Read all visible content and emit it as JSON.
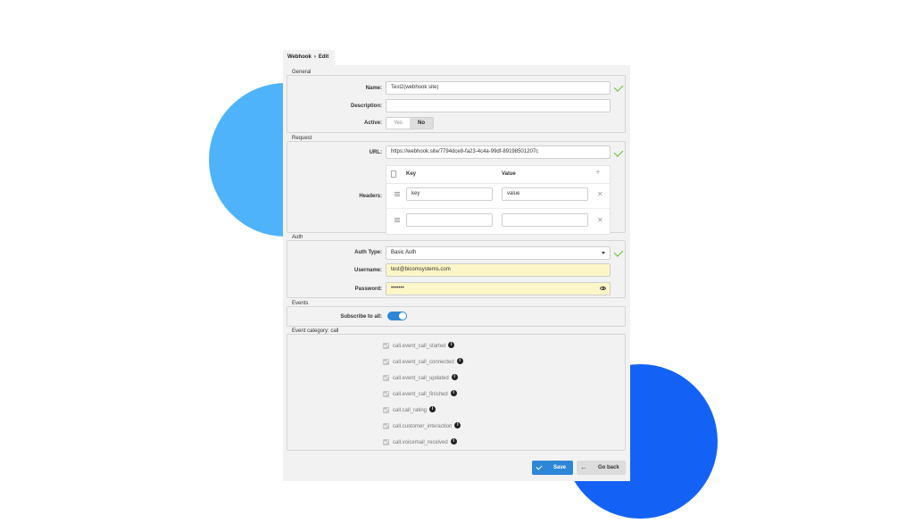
{
  "breadcrumb": {
    "root": "Webhook",
    "separator": "›",
    "current": "Edit"
  },
  "general": {
    "title": "General",
    "name_label": "Name:",
    "name_value": "Test2(webhook site)",
    "description_label": "Description:",
    "description_value": "",
    "active_label": "Active:",
    "active_yes": "Yes",
    "active_no": "No",
    "active_selected": "No"
  },
  "request": {
    "title": "Request",
    "url_label": "URL:",
    "url_value": "https://webhook.site/7794dce8-fa23-4c4a-99df-89198501207c",
    "headers_label": "Headers:",
    "col_key": "Key",
    "col_value": "Value",
    "rows": [
      {
        "key": "key",
        "value": "value"
      },
      {
        "key": "",
        "value": ""
      }
    ]
  },
  "auth": {
    "title": "Auth",
    "type_label": "Auth Type:",
    "type_value": "Basic Auth",
    "username_label": "Username:",
    "username_value": "test@bicomsystems.com",
    "password_label": "Password:",
    "password_value": "•••••••"
  },
  "events": {
    "title": "Events",
    "subscribe_label": "Subscribe to all:",
    "subscribe_on": true
  },
  "event_category": {
    "title": "Event category: call",
    "items": [
      "call.event_call_started",
      "call.event_call_connected",
      "call.event_call_updated",
      "call.event_call_finished",
      "call.call_rating",
      "call.customer_interaction",
      "call.voicemail_received"
    ]
  },
  "actions": {
    "save_label": "Save",
    "back_label": "Go back"
  },
  "colors": {
    "accent": "#2e86d6",
    "valid": "#5bbf2c",
    "deco_light": "#4fb3fb",
    "deco_dark": "#1462f5"
  }
}
